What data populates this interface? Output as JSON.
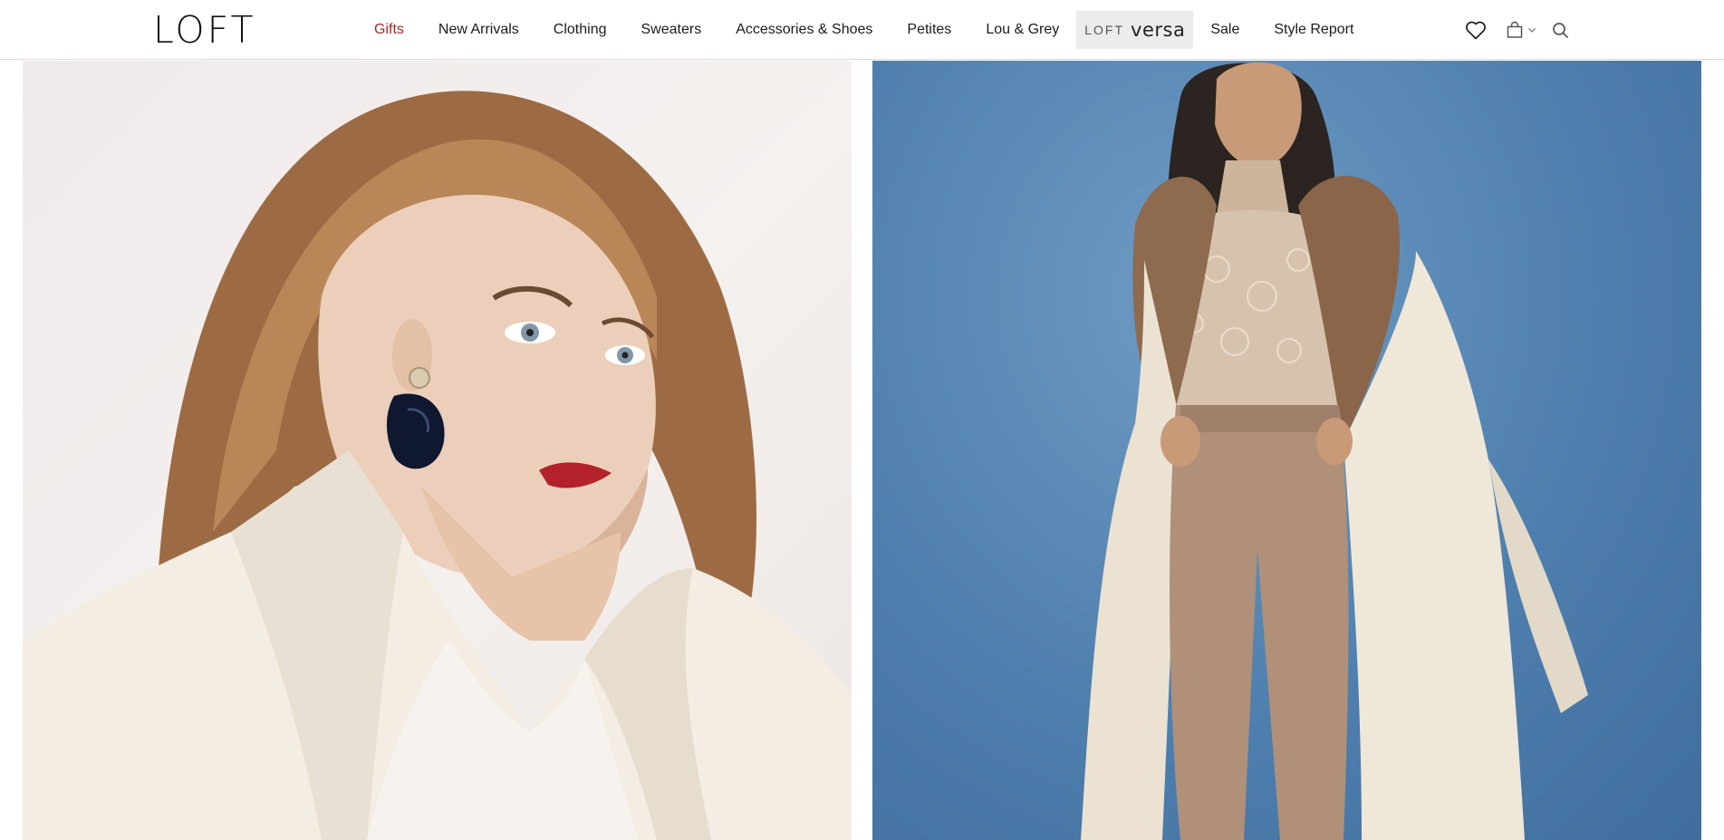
{
  "header": {
    "logo": "LOFT",
    "nav": [
      {
        "label": "Gifts",
        "active": true
      },
      {
        "label": "New Arrivals"
      },
      {
        "label": "Clothing"
      },
      {
        "label": "Sweaters"
      },
      {
        "label": "Accessories & Shoes"
      },
      {
        "label": "Petites"
      },
      {
        "label": "Lou & Grey"
      },
      {
        "label_prefix": "LOFT",
        "label": "versa",
        "highlighted": true
      },
      {
        "label": "Sale"
      },
      {
        "label": "Style Report"
      }
    ],
    "icons": [
      "heart-icon",
      "shopping-bag-icon",
      "chevron-down-icon",
      "search-icon"
    ]
  },
  "hero_images": [
    {
      "name": "hero-image-left"
    },
    {
      "name": "hero-image-right"
    }
  ],
  "colors": {
    "active_nav": "#a12a2a",
    "text": "#1b1b1b",
    "versa_bg": "#ececec",
    "right_bg": "#4f7fae"
  }
}
